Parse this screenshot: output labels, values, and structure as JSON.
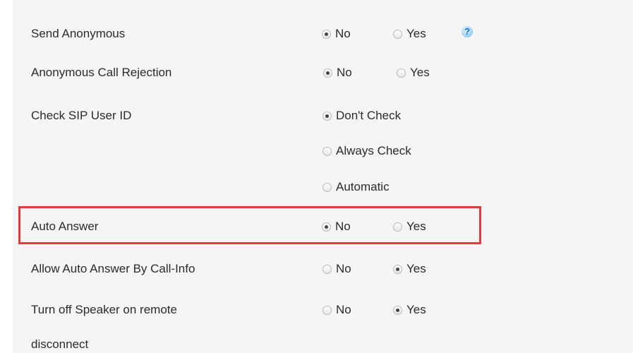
{
  "settings": [
    {
      "label": "Send Anonymous",
      "options": [
        {
          "text": "No",
          "checked": true
        },
        {
          "text": "Yes",
          "checked": false
        }
      ],
      "has_help": true
    },
    {
      "label": "Anonymous Call Rejection",
      "options": [
        {
          "text": "No",
          "checked": true
        },
        {
          "text": "Yes",
          "checked": false
        }
      ]
    },
    {
      "label": "Check SIP User ID",
      "options": [
        {
          "text": "Don't Check",
          "checked": true
        },
        {
          "text": "Always Check",
          "checked": false
        },
        {
          "text": "Automatic",
          "checked": false
        }
      ]
    },
    {
      "label": "Auto Answer",
      "options": [
        {
          "text": "No",
          "checked": true
        },
        {
          "text": "Yes",
          "checked": false
        }
      ],
      "highlighted": true
    },
    {
      "label": "Allow Auto Answer By Call-Info",
      "options": [
        {
          "text": "No",
          "checked": false
        },
        {
          "text": "Yes",
          "checked": true
        }
      ]
    },
    {
      "label_line1": "Turn off Speaker on remote",
      "label_line2": "disconnect",
      "options": [
        {
          "text": "No",
          "checked": false
        },
        {
          "text": "Yes",
          "checked": true
        }
      ]
    }
  ],
  "help_icon_glyph": "?",
  "colors": {
    "highlight_border": "#e23b3b",
    "panel_background": "#f5f5f5"
  }
}
